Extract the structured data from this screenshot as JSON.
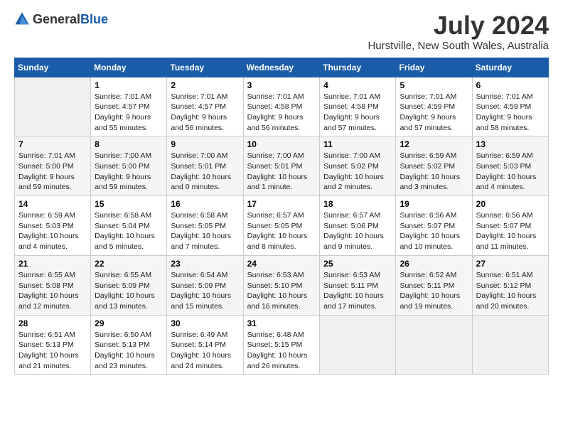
{
  "logo": {
    "general": "General",
    "blue": "Blue"
  },
  "title": "July 2024",
  "subtitle": "Hurstville, New South Wales, Australia",
  "days_header": [
    "Sunday",
    "Monday",
    "Tuesday",
    "Wednesday",
    "Thursday",
    "Friday",
    "Saturday"
  ],
  "weeks": [
    [
      {
        "num": "",
        "sunrise": "",
        "sunset": "",
        "daylight": "",
        "empty": true
      },
      {
        "num": "1",
        "sunrise": "Sunrise: 7:01 AM",
        "sunset": "Sunset: 4:57 PM",
        "daylight": "Daylight: 9 hours and 55 minutes."
      },
      {
        "num": "2",
        "sunrise": "Sunrise: 7:01 AM",
        "sunset": "Sunset: 4:57 PM",
        "daylight": "Daylight: 9 hours and 56 minutes."
      },
      {
        "num": "3",
        "sunrise": "Sunrise: 7:01 AM",
        "sunset": "Sunset: 4:58 PM",
        "daylight": "Daylight: 9 hours and 56 minutes."
      },
      {
        "num": "4",
        "sunrise": "Sunrise: 7:01 AM",
        "sunset": "Sunset: 4:58 PM",
        "daylight": "Daylight: 9 hours and 57 minutes."
      },
      {
        "num": "5",
        "sunrise": "Sunrise: 7:01 AM",
        "sunset": "Sunset: 4:59 PM",
        "daylight": "Daylight: 9 hours and 57 minutes."
      },
      {
        "num": "6",
        "sunrise": "Sunrise: 7:01 AM",
        "sunset": "Sunset: 4:59 PM",
        "daylight": "Daylight: 9 hours and 58 minutes."
      }
    ],
    [
      {
        "num": "7",
        "sunrise": "Sunrise: 7:01 AM",
        "sunset": "Sunset: 5:00 PM",
        "daylight": "Daylight: 9 hours and 59 minutes."
      },
      {
        "num": "8",
        "sunrise": "Sunrise: 7:00 AM",
        "sunset": "Sunset: 5:00 PM",
        "daylight": "Daylight: 9 hours and 59 minutes."
      },
      {
        "num": "9",
        "sunrise": "Sunrise: 7:00 AM",
        "sunset": "Sunset: 5:01 PM",
        "daylight": "Daylight: 10 hours and 0 minutes."
      },
      {
        "num": "10",
        "sunrise": "Sunrise: 7:00 AM",
        "sunset": "Sunset: 5:01 PM",
        "daylight": "Daylight: 10 hours and 1 minute."
      },
      {
        "num": "11",
        "sunrise": "Sunrise: 7:00 AM",
        "sunset": "Sunset: 5:02 PM",
        "daylight": "Daylight: 10 hours and 2 minutes."
      },
      {
        "num": "12",
        "sunrise": "Sunrise: 6:59 AM",
        "sunset": "Sunset: 5:02 PM",
        "daylight": "Daylight: 10 hours and 3 minutes."
      },
      {
        "num": "13",
        "sunrise": "Sunrise: 6:59 AM",
        "sunset": "Sunset: 5:03 PM",
        "daylight": "Daylight: 10 hours and 4 minutes."
      }
    ],
    [
      {
        "num": "14",
        "sunrise": "Sunrise: 6:59 AM",
        "sunset": "Sunset: 5:03 PM",
        "daylight": "Daylight: 10 hours and 4 minutes."
      },
      {
        "num": "15",
        "sunrise": "Sunrise: 6:58 AM",
        "sunset": "Sunset: 5:04 PM",
        "daylight": "Daylight: 10 hours and 5 minutes."
      },
      {
        "num": "16",
        "sunrise": "Sunrise: 6:58 AM",
        "sunset": "Sunset: 5:05 PM",
        "daylight": "Daylight: 10 hours and 7 minutes."
      },
      {
        "num": "17",
        "sunrise": "Sunrise: 6:57 AM",
        "sunset": "Sunset: 5:05 PM",
        "daylight": "Daylight: 10 hours and 8 minutes."
      },
      {
        "num": "18",
        "sunrise": "Sunrise: 6:57 AM",
        "sunset": "Sunset: 5:06 PM",
        "daylight": "Daylight: 10 hours and 9 minutes."
      },
      {
        "num": "19",
        "sunrise": "Sunrise: 6:56 AM",
        "sunset": "Sunset: 5:07 PM",
        "daylight": "Daylight: 10 hours and 10 minutes."
      },
      {
        "num": "20",
        "sunrise": "Sunrise: 6:56 AM",
        "sunset": "Sunset: 5:07 PM",
        "daylight": "Daylight: 10 hours and 11 minutes."
      }
    ],
    [
      {
        "num": "21",
        "sunrise": "Sunrise: 6:55 AM",
        "sunset": "Sunset: 5:08 PM",
        "daylight": "Daylight: 10 hours and 12 minutes."
      },
      {
        "num": "22",
        "sunrise": "Sunrise: 6:55 AM",
        "sunset": "Sunset: 5:09 PM",
        "daylight": "Daylight: 10 hours and 13 minutes."
      },
      {
        "num": "23",
        "sunrise": "Sunrise: 6:54 AM",
        "sunset": "Sunset: 5:09 PM",
        "daylight": "Daylight: 10 hours and 15 minutes."
      },
      {
        "num": "24",
        "sunrise": "Sunrise: 6:53 AM",
        "sunset": "Sunset: 5:10 PM",
        "daylight": "Daylight: 10 hours and 16 minutes."
      },
      {
        "num": "25",
        "sunrise": "Sunrise: 6:53 AM",
        "sunset": "Sunset: 5:11 PM",
        "daylight": "Daylight: 10 hours and 17 minutes."
      },
      {
        "num": "26",
        "sunrise": "Sunrise: 6:52 AM",
        "sunset": "Sunset: 5:11 PM",
        "daylight": "Daylight: 10 hours and 19 minutes."
      },
      {
        "num": "27",
        "sunrise": "Sunrise: 6:51 AM",
        "sunset": "Sunset: 5:12 PM",
        "daylight": "Daylight: 10 hours and 20 minutes."
      }
    ],
    [
      {
        "num": "28",
        "sunrise": "Sunrise: 6:51 AM",
        "sunset": "Sunset: 5:13 PM",
        "daylight": "Daylight: 10 hours and 21 minutes."
      },
      {
        "num": "29",
        "sunrise": "Sunrise: 6:50 AM",
        "sunset": "Sunset: 5:13 PM",
        "daylight": "Daylight: 10 hours and 23 minutes."
      },
      {
        "num": "30",
        "sunrise": "Sunrise: 6:49 AM",
        "sunset": "Sunset: 5:14 PM",
        "daylight": "Daylight: 10 hours and 24 minutes."
      },
      {
        "num": "31",
        "sunrise": "Sunrise: 6:48 AM",
        "sunset": "Sunset: 5:15 PM",
        "daylight": "Daylight: 10 hours and 26 minutes."
      },
      {
        "num": "",
        "sunrise": "",
        "sunset": "",
        "daylight": "",
        "empty": true
      },
      {
        "num": "",
        "sunrise": "",
        "sunset": "",
        "daylight": "",
        "empty": true
      },
      {
        "num": "",
        "sunrise": "",
        "sunset": "",
        "daylight": "",
        "empty": true
      }
    ]
  ]
}
